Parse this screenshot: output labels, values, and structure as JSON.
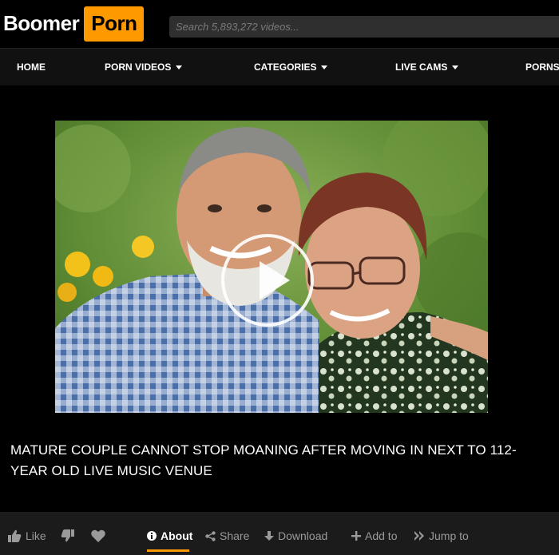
{
  "logo": {
    "left": "Boomer",
    "right": "Porn"
  },
  "search": {
    "placeholder": "Search 5,893,272 videos..."
  },
  "nav": {
    "items": [
      {
        "label": "HOME"
      },
      {
        "label": "PORN VIDEOS"
      },
      {
        "label": "CATEGORIES"
      },
      {
        "label": "LIVE CAMS"
      },
      {
        "label": "PORNS"
      }
    ]
  },
  "video": {
    "title": "MATURE COUPLE CANNOT STOP MOANING AFTER MOVING IN NEXT TO 112-YEAR OLD LIVE MUSIC VENUE"
  },
  "actions": {
    "like": "Like",
    "about": "About",
    "share": "Share",
    "download": "Download",
    "add_to": "Add to",
    "jump_to": "Jump to"
  },
  "colors": {
    "brand": "#ff9900",
    "background": "#000000",
    "bar": "#1b1b1b"
  }
}
